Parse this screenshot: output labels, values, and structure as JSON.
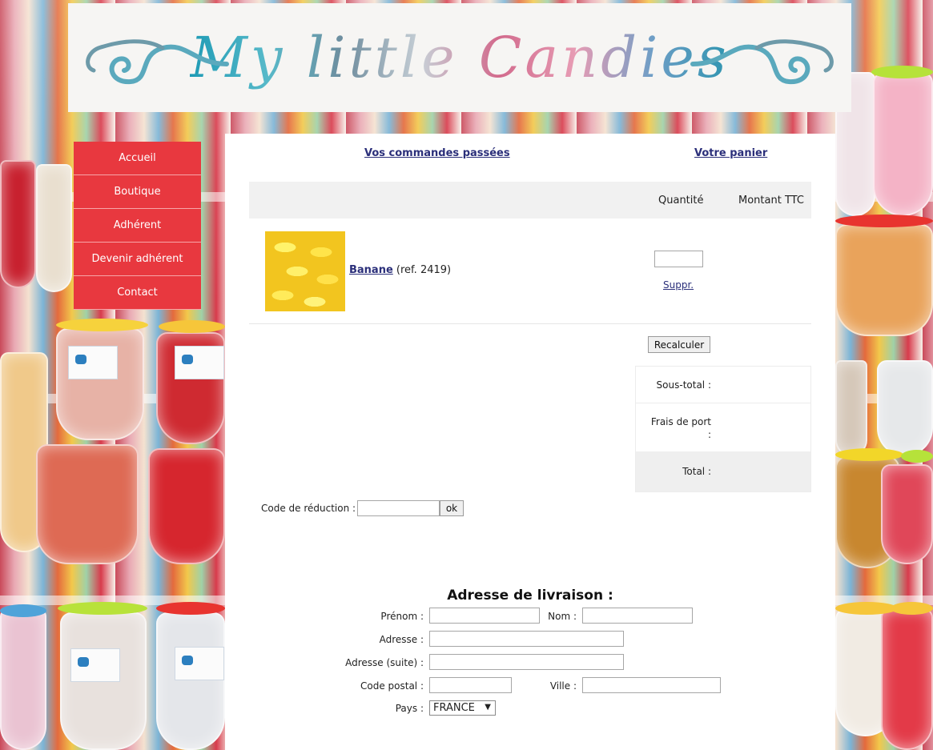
{
  "site": {
    "logo_text": "My little Candies"
  },
  "nav": {
    "items": [
      {
        "label": "Accueil"
      },
      {
        "label": "Boutique"
      },
      {
        "label": "Adhérent"
      },
      {
        "label": "Devenir adhérent"
      },
      {
        "label": "Contact"
      }
    ]
  },
  "toplinks": {
    "orders": "Vos commandes passées",
    "cart": "Votre panier"
  },
  "cart": {
    "headers": {
      "quantity": "Quantité",
      "amount": "Montant TTC"
    },
    "item": {
      "name": "Banane",
      "ref": "(ref. 2419)",
      "quantity_value": "",
      "remove_label": "Suppr."
    },
    "recalc_label": "Recalculer",
    "subtotal_label": "Sous-total :",
    "shipping_label_1": "Frais de port",
    "shipping_label_2": ":",
    "total_label": "Total :"
  },
  "promo": {
    "label": "Code de réduction :",
    "value": "",
    "button_label": "ok"
  },
  "address": {
    "title": "Adresse de livraison :",
    "firstname_label": "Prénom :",
    "lastname_label": "Nom :",
    "address_label": "Adresse :",
    "address2_label": "Adresse (suite) :",
    "postal_label": "Code postal :",
    "city_label": "Ville :",
    "country_label": "Pays :",
    "country_value": "FRANCE"
  },
  "colors": {
    "nav_bg": "#e8383f",
    "link": "#2b2f7a"
  }
}
